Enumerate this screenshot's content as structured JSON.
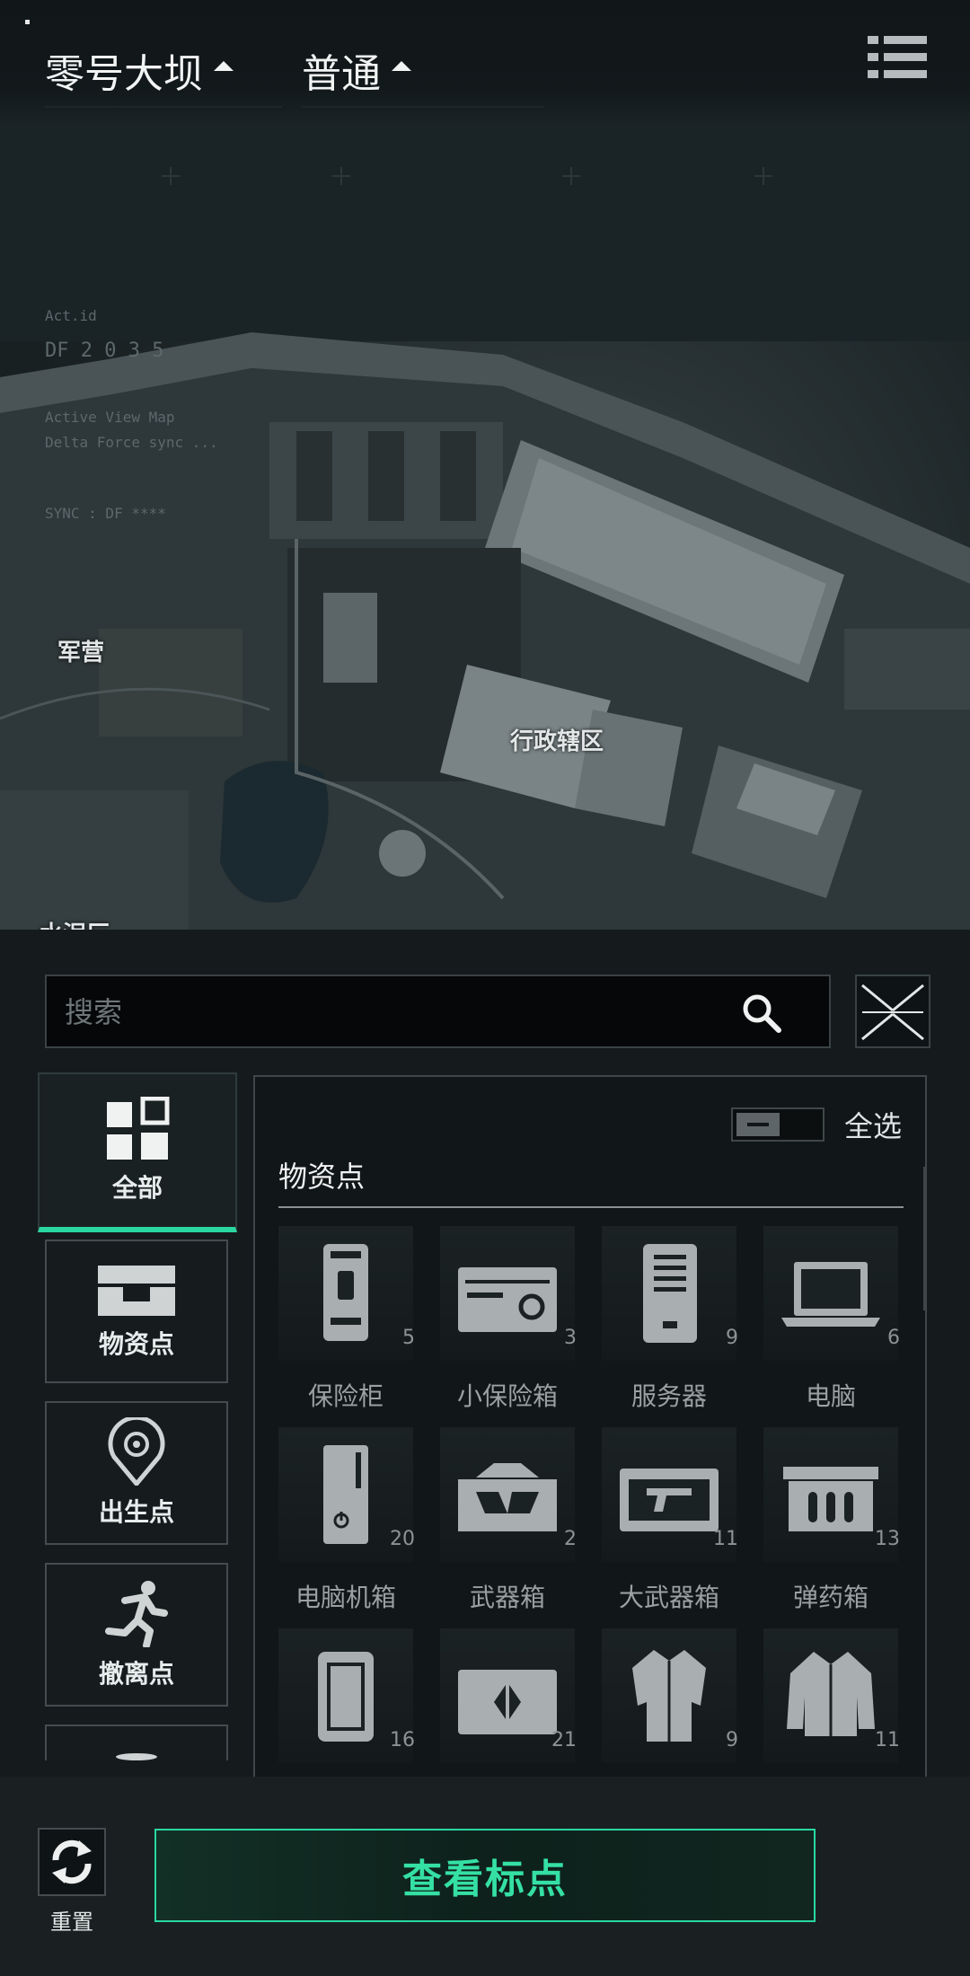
{
  "top": {
    "map_dropdown": "零号大坝",
    "mode_dropdown": "普通"
  },
  "hud": {
    "line1": "Act.id",
    "line2": "DF  2  0  3  5",
    "line3": "Active View Map",
    "line4": "Delta Force sync ...",
    "line5": "SYNC : DF ****"
  },
  "map_labels": {
    "barracks": "军营",
    "admin": "行政辖区",
    "partial": "水泥厂"
  },
  "search": {
    "placeholder": "搜索"
  },
  "categories": [
    {
      "label": "全部",
      "icon": "grid-icon",
      "active": true
    },
    {
      "label": "物资点",
      "icon": "supply-crate-icon"
    },
    {
      "label": "出生点",
      "icon": "spawn-point-icon"
    },
    {
      "label": "撤离点",
      "icon": "extract-runner-icon"
    }
  ],
  "list": {
    "select_all": "全选",
    "section_title": "物资点",
    "items": [
      {
        "name": "保险柜",
        "count": "5",
        "icon": "safe-icon"
      },
      {
        "name": "小保险箱",
        "count": "3",
        "icon": "small-safe-icon"
      },
      {
        "name": "服务器",
        "count": "9",
        "icon": "server-icon"
      },
      {
        "name": "电脑",
        "count": "6",
        "icon": "laptop-icon"
      },
      {
        "name": "电脑机箱",
        "count": "20",
        "icon": "pc-case-icon"
      },
      {
        "name": "武器箱",
        "count": "2",
        "icon": "weapon-case-icon"
      },
      {
        "name": "大武器箱",
        "count": "11",
        "icon": "large-weapon-case-icon"
      },
      {
        "name": "弹药箱",
        "count": "13",
        "icon": "ammo-box-icon"
      },
      {
        "name": "",
        "count": "16",
        "icon": "travel-case-icon"
      },
      {
        "name": "",
        "count": "21",
        "icon": "medical-crate-icon"
      },
      {
        "name": "",
        "count": "9",
        "icon": "coat-icon"
      },
      {
        "name": "",
        "count": "11",
        "icon": "jacket-icon"
      }
    ]
  },
  "bottom": {
    "reset_label": "重置",
    "view_button": "查看标点"
  },
  "colors": {
    "accent": "#2ad7a0",
    "background": "#151b1d"
  }
}
